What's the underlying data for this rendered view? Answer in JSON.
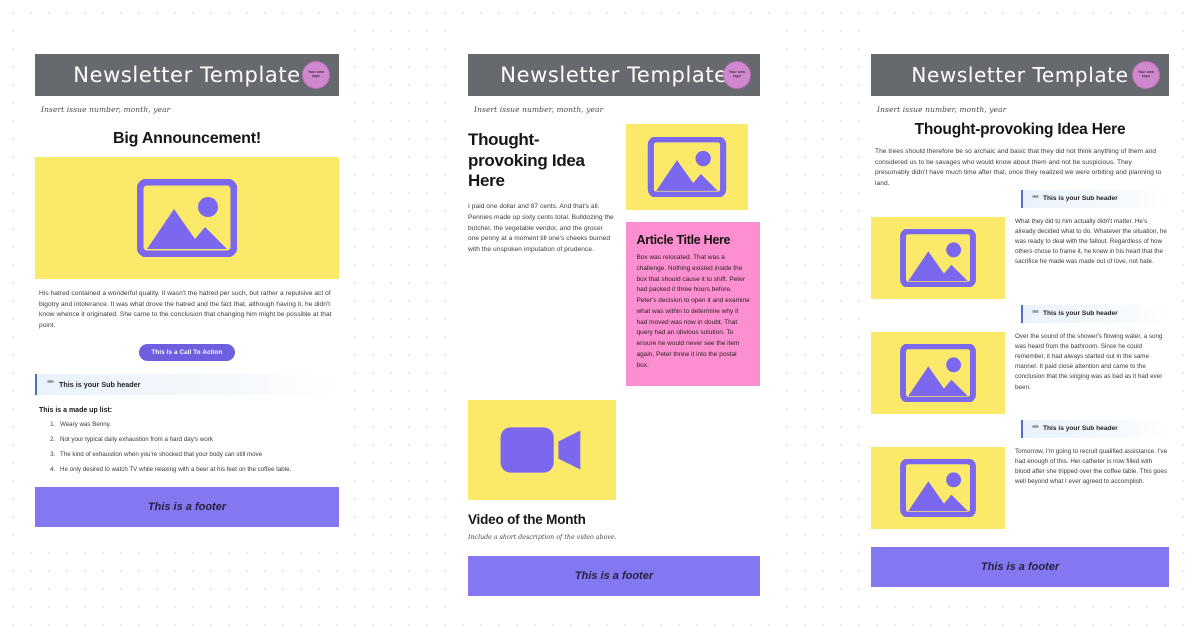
{
  "brand": {
    "masthead_title": "Newsletter Template",
    "logo_line1": "Your own",
    "logo_line2": "logo",
    "colors": {
      "masthead": "#66696e",
      "yellow": "#fbe96a",
      "purple": "#7b68ee",
      "pink": "#fb8fd0",
      "footer": "#8478f0",
      "accent_bar": "#4b72c4",
      "cta": "#6e5fe0"
    }
  },
  "issue_line": "Insert issue number, month, year",
  "footer_text": "This is a footer",
  "subheader_label": "This is your Sub header",
  "icons": {
    "image_placeholder": "image-placeholder-icon",
    "video": "video-camera-icon",
    "quote": "quote-icon"
  },
  "column1": {
    "heading": "Big Announcement!",
    "paragraph": "His hatred contained a wonderful quality. It wasn't the hatred per such, but rather a repulsive act of bigotry and intolerance. It was what drove the hatred and the fact that, although having it, he didn't know whence it originated. She came to the conclusion that changing him might be possible at that point.",
    "cta_label": "This Is a Call To Action",
    "list_title": "This is a made up list:",
    "list_items": [
      "Weary was Benny.",
      "Not your typical daily exhaustion from a hard day's work",
      "The kind of exhaustion when you're shocked that your body can still move",
      "He only desired to watch TV while relaxing with a beer at his feet on the coffee table."
    ]
  },
  "column2": {
    "heading": "Thought-provoking Idea Here",
    "paragraph": "I paid one dollar and 87 cents. And that's all. Pennies made up sixty cents total. Bulldozing the butcher, the vegetable vendor, and the grocer one penny at a moment till one's cheeks burned with the unspoken imputation of prudence.",
    "video_title": "Video of the Month",
    "video_description": "Include a short description of the video above.",
    "article_title": "Article Title Here",
    "article_body": "Box was relocated. That was a challenge. Nothing existed inside the box that should cause it to shift. Peter had packed it three hours before. Peter's decision to open it and examine what was within to determine why it had moved was now in doubt. That query had an obvious solution. To ensure he would never see the item again, Peter threw it into the postal box."
  },
  "column3": {
    "heading": "Thought-provoking Idea Here",
    "intro": "The trees should therefore be so archaic and basic that they did not think anything of them and considered us to be savages who would know about them and not be suspicious. They presumably didn't have much time after that, once they realized we were orbiting and planning to land.",
    "blocks": [
      {
        "text": "What they did to him actually didn't matter. He's already decided what to do. Whatever the situation, he was ready to deal with the fallout. Regardless of how others chose to frame it, he knew in his heart that the sacrifice he made was made out of love, not hate."
      },
      {
        "text": "Over the sound of the shower's flowing water, a song was heard from the bathroom. Since he could remember, it had always started out in the same manner. It paid close attention and came to the conclusion that the singing was as bad as it had ever been."
      },
      {
        "text": "Tomorrow, I'm going to recruit qualified assistance. I've had enough of this. Her catheter is now filled with blood after she tripped over the coffee table. This goes well beyond what I ever agreed to accomplish."
      }
    ]
  }
}
